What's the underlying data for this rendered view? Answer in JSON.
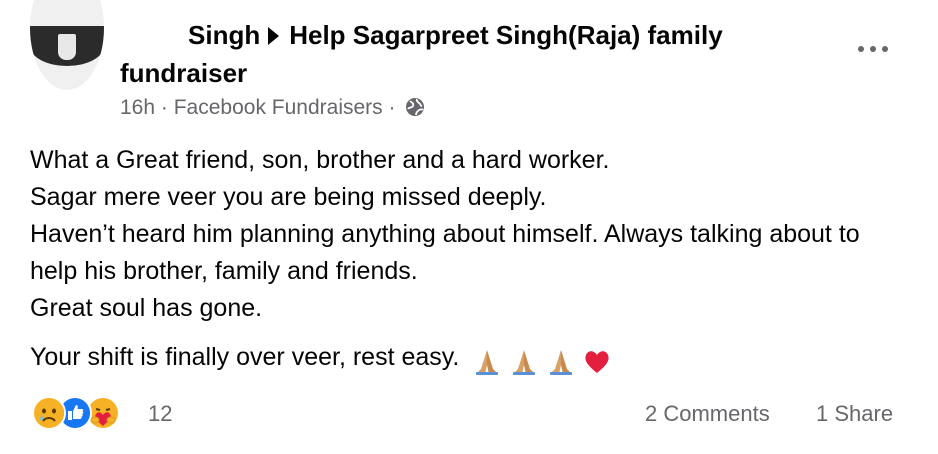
{
  "post": {
    "author": "Singh",
    "target": "Help Sagarpreet Singh(Raja) family",
    "target_cont": "fundraiser",
    "time": "16h",
    "separator": "·",
    "source": "Facebook Fundraisers",
    "audience_icon": "globe-icon",
    "more_icon": "more-options-icon",
    "body": [
      "What a Great friend, son, brother and a hard worker.",
      "Sagar mere veer you are being missed deeply.",
      "Haven’t heard him planning anything about himself. Always talking about to help his brother, family and friends.",
      "Great soul has gone."
    ],
    "closing": "Your shift is finally over veer, rest easy.",
    "closing_emojis": [
      "folded-hands",
      "folded-hands",
      "folded-hands",
      "red-heart"
    ]
  },
  "footer": {
    "reactions": [
      "sad-reaction-icon",
      "like-reaction-icon",
      "care-reaction-icon"
    ],
    "reaction_count": "12",
    "comments": "2 Comments",
    "shares": "1 Share"
  },
  "colors": {
    "text": "#050505",
    "secondary": "#65676b",
    "like_blue": "#1877f2",
    "emoji_yellow": "#f7b125",
    "heart_red": "#e41e3f"
  }
}
